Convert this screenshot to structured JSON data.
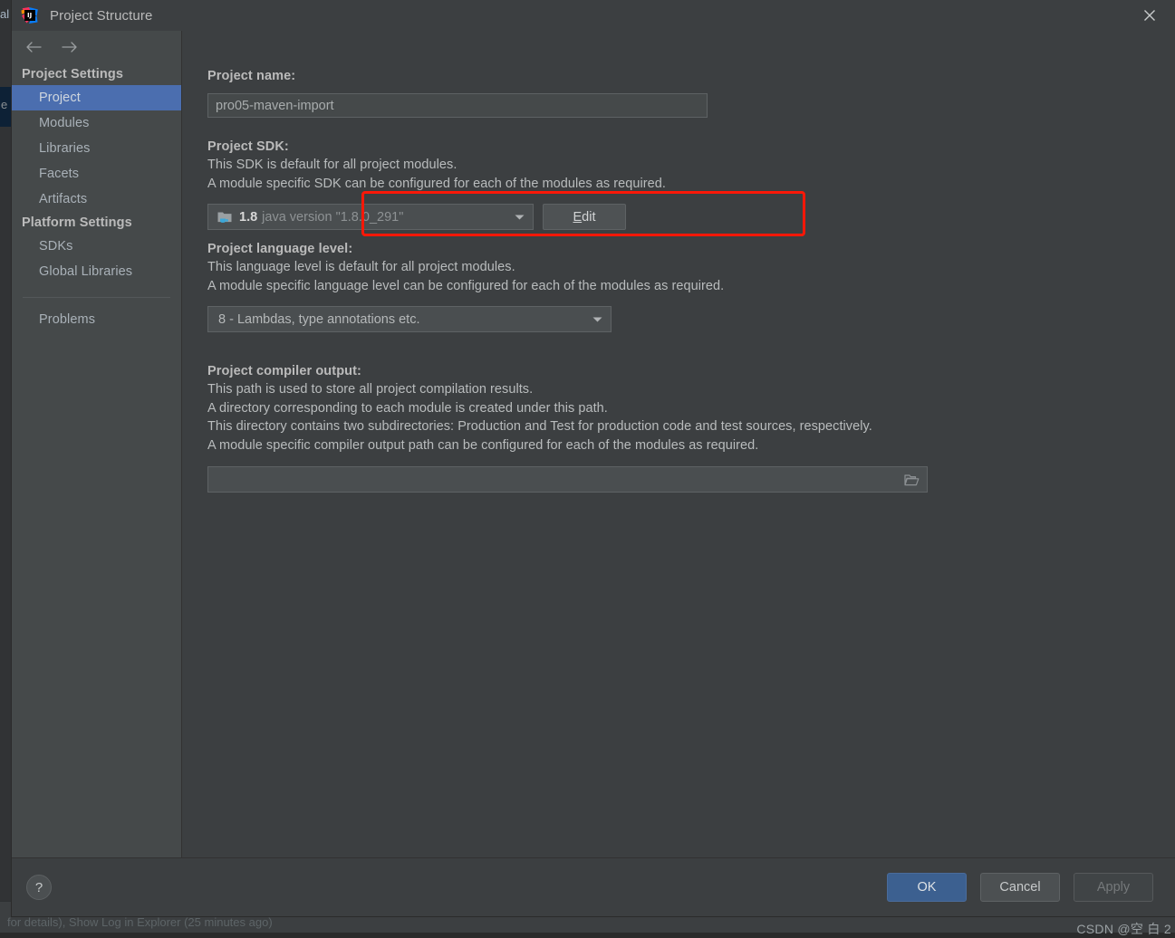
{
  "backdrop": {
    "tab_fragment": "al",
    "editor_letter": "e",
    "status_text": "for details), Show Log in Explorer (25 minutes ago)"
  },
  "titlebar": {
    "app_icon": "intellij-idea-icon",
    "title": "Project Structure",
    "close_icon": "close-icon"
  },
  "sidebar": {
    "back_icon": "arrow-left-icon",
    "forward_icon": "arrow-right-icon",
    "groups": [
      {
        "title": "Project Settings",
        "items": [
          {
            "label": "Project",
            "selected": true
          },
          {
            "label": "Modules",
            "selected": false
          },
          {
            "label": "Libraries",
            "selected": false
          },
          {
            "label": "Facets",
            "selected": false
          },
          {
            "label": "Artifacts",
            "selected": false
          }
        ]
      },
      {
        "title": "Platform Settings",
        "items": [
          {
            "label": "SDKs",
            "selected": false
          },
          {
            "label": "Global Libraries",
            "selected": false
          }
        ]
      }
    ],
    "extra_items": [
      {
        "label": "Problems",
        "selected": false
      }
    ]
  },
  "main": {
    "project_name": {
      "label": "Project name:",
      "value": "pro05-maven-import"
    },
    "project_sdk": {
      "label": "Project SDK:",
      "desc_line1": "This SDK is default for all project modules.",
      "desc_line2": "A module specific SDK can be configured for each of the modules as required.",
      "sdk_icon": "java-sdk-folder-icon",
      "sdk_name": "1.8",
      "sdk_version": "java version \"1.8.0_291\"",
      "dropdown_icon": "chevron-down-icon",
      "edit_button": "Edit",
      "edit_button_mnemonic": "E",
      "edit_button_rest": "dit",
      "highlight_color": "#fb1808"
    },
    "language_level": {
      "label": "Project language level:",
      "desc_line1": "This language level is default for all project modules.",
      "desc_line2": "A module specific language level can be configured for each of the modules as required.",
      "value": "8 - Lambdas, type annotations etc.",
      "dropdown_icon": "chevron-down-icon"
    },
    "compiler_output": {
      "label": "Project compiler output:",
      "desc_line1": "This path is used to store all project compilation results.",
      "desc_line2": "A directory corresponding to each module is created under this path.",
      "desc_line3": "This directory contains two subdirectories: Production and Test for production code and test sources, respectively.",
      "desc_line4": "A module specific compiler output path can be configured for each of the modules as required.",
      "value": "",
      "browse_icon": "folder-open-icon"
    }
  },
  "footer": {
    "help_label": "?",
    "help_icon": "question-mark-icon",
    "ok_label": "OK",
    "cancel_label": "Cancel",
    "apply_label": "Apply",
    "ok_color": "#3c6090"
  },
  "watermark": {
    "text": "CSDN @空 白 2"
  }
}
